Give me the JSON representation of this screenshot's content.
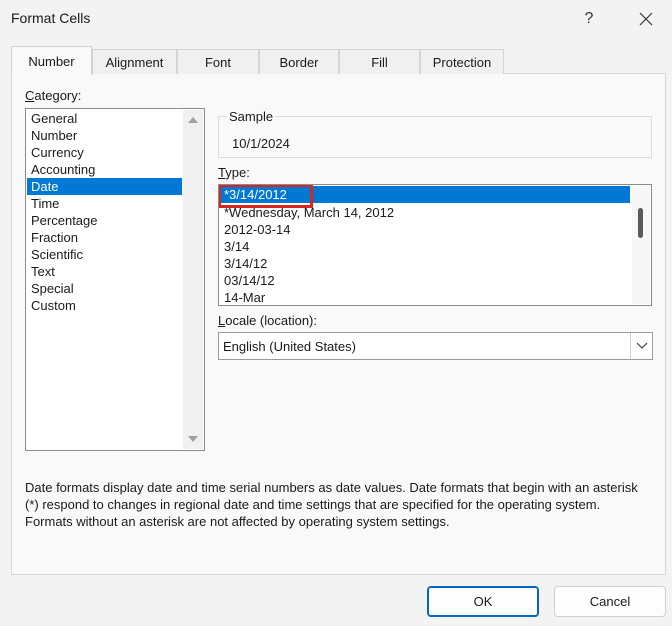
{
  "window": {
    "title": "Format Cells",
    "help_label": "?"
  },
  "tabs": [
    {
      "label": "Number",
      "active": true
    },
    {
      "label": "Alignment"
    },
    {
      "label": "Font"
    },
    {
      "label": "Border"
    },
    {
      "label": "Fill"
    },
    {
      "label": "Protection"
    }
  ],
  "category": {
    "label_prefix": "C",
    "label_rest": "ategory:",
    "items": [
      "General",
      "Number",
      "Currency",
      "Accounting",
      "Date",
      "Time",
      "Percentage",
      "Fraction",
      "Scientific",
      "Text",
      "Special",
      "Custom"
    ],
    "selected": "Date"
  },
  "sample": {
    "label": "Sample",
    "value": "10/1/2024"
  },
  "type": {
    "label_prefix": "T",
    "label_rest": "ype:",
    "items": [
      "*3/14/2012",
      "*Wednesday, March 14, 2012",
      "2012-03-14",
      "3/14",
      "3/14/12",
      "03/14/12",
      "14-Mar"
    ],
    "selected": "*3/14/2012"
  },
  "locale": {
    "label_prefix": "L",
    "label_rest": "ocale (location):",
    "value": "English (United States)"
  },
  "description": {
    "lines": [
      "Date formats display date and time serial numbers as date values.  Date formats that begin with an asterisk",
      "(*) respond to changes in regional date and time settings that are specified for the operating system.",
      "Formats without an asterisk are not affected by operating system settings."
    ]
  },
  "buttons": {
    "ok": "OK",
    "cancel": "Cancel"
  },
  "colors": {
    "selection": "#0078d4",
    "highlight_border": "#d9261c",
    "default_button_border": "#0067c0"
  }
}
